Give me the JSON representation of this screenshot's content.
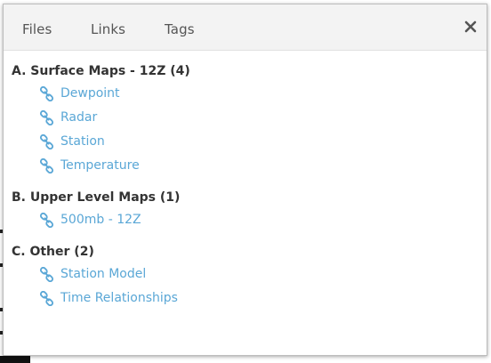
{
  "tabs": [
    {
      "label": "Files"
    },
    {
      "label": "Links"
    },
    {
      "label": "Tags"
    }
  ],
  "close_icon": "close-icon",
  "link_icon": "link-icon",
  "colors": {
    "link": "#5aa7d6",
    "group_title": "#333333",
    "tab_text": "#555555",
    "tab_bar": "#f3f3f3"
  },
  "groups": [
    {
      "title": "A. Surface Maps - 12Z (4)",
      "links": [
        {
          "label": "Dewpoint"
        },
        {
          "label": "Radar"
        },
        {
          "label": "Station"
        },
        {
          "label": "Temperature"
        }
      ]
    },
    {
      "title": "B. Upper Level Maps (1)",
      "links": [
        {
          "label": "500mb - 12Z"
        }
      ]
    },
    {
      "title": "C. Other (2)",
      "links": [
        {
          "label": "Station Model"
        },
        {
          "label": "Time Relationships"
        }
      ]
    }
  ]
}
